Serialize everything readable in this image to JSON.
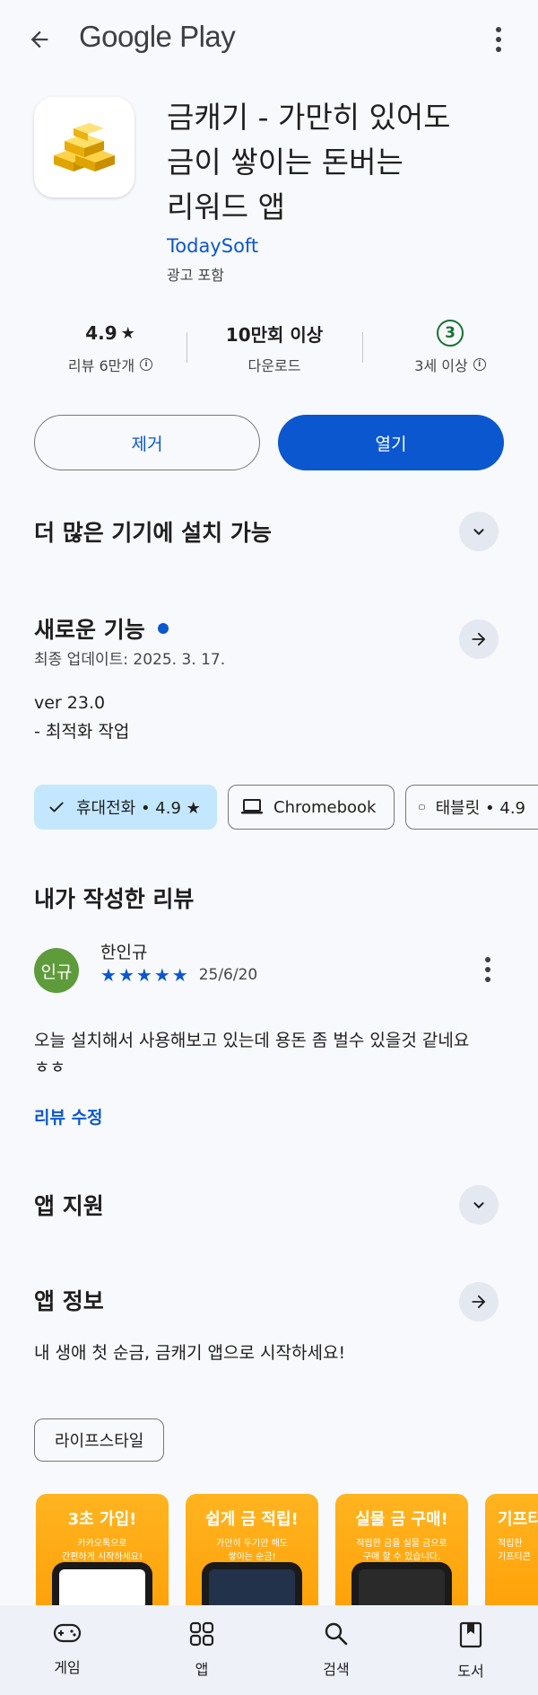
{
  "topbar": {
    "brand": "Google Play",
    "back_icon": "arrow-back-icon",
    "more_icon": "more-vert-icon"
  },
  "app": {
    "title_lines": [
      "금캐기 - 가만히 있어도",
      "금이 쌓이는 돈버는",
      "리워드 앱"
    ],
    "developer": "TodaySoft",
    "ads_label": "광고 포함",
    "icon": "gold-bars-icon"
  },
  "stats": {
    "rating": {
      "value": "4.9",
      "label": "리뷰 6만개"
    },
    "downloads": {
      "value": "10만회 이상",
      "label": "다운로드"
    },
    "age": {
      "value": "3",
      "label": "3세 이상"
    }
  },
  "actions": {
    "remove_label": "제거",
    "open_label": "열기"
  },
  "devices_section": {
    "title": "더 많은 기기에 설치 가능"
  },
  "whats_new": {
    "title": "새로운 기능",
    "updated": "최종 업데이트: 2025. 3. 17.",
    "version": "ver 23.0",
    "note": "- 최적화 작업"
  },
  "device_chips": [
    {
      "label": "휴대전화 • 4.9 ★",
      "selected": true,
      "icon": "check-icon"
    },
    {
      "label": "Chromebook",
      "selected": false,
      "icon": "laptop-icon"
    },
    {
      "label": "태블릿 • 4.9",
      "selected": false,
      "icon": "tablet-icon"
    }
  ],
  "my_review": {
    "title": "내가 작성한 리뷰",
    "avatar_text": "인규",
    "author": "한인규",
    "rating": 5,
    "date": "25/6/20",
    "text_lines": [
      "오늘 설치해서 사용해보고 있는데 용돈 좀 벌수 있을것 같네요",
      "ㅎㅎ"
    ],
    "edit_label": "리뷰 수정"
  },
  "app_support": {
    "title": "앱 지원"
  },
  "app_info": {
    "title": "앱 정보",
    "description": "내 생애 첫 순금, 금캐기 앱으로 시작하세요!"
  },
  "category_tag": "라이프스타일",
  "screenshots": [
    {
      "headline": "3초 가입!",
      "sub_lines": [
        "카카오톡으로",
        "간편하게 시작하세요!"
      ]
    },
    {
      "headline": "쉽게 금 적립!",
      "sub_lines": [
        "가만히 두기만 해도",
        "쌓이는 순금!"
      ]
    },
    {
      "headline": "실물 금 구매!",
      "sub_lines": [
        "적립한 금을 실물 금으로",
        "구매 할 수 있습니다."
      ]
    },
    {
      "headline": "기프티",
      "sub_lines": [
        "적립한",
        "기프티콘"
      ]
    }
  ],
  "bottom_nav": [
    {
      "label": "게임",
      "icon": "gamepad-icon"
    },
    {
      "label": "앱",
      "icon": "apps-grid-icon"
    },
    {
      "label": "검색",
      "icon": "search-icon"
    },
    {
      "label": "도서",
      "icon": "bookmark-icon"
    }
  ],
  "colors": {
    "accent": "#0b57d0",
    "background": "#f8f9fc",
    "chip_selected": "#c2e7ff",
    "age_green": "#137333",
    "avatar": "#5e9b3b",
    "screenshot_orange": "#ffa500"
  }
}
